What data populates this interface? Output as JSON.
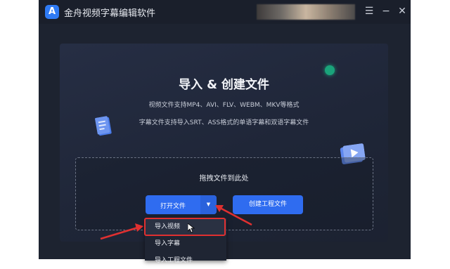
{
  "app": {
    "title": "金舟视频字幕编辑软件",
    "logo_letter": "A",
    "window_controls": {
      "menu": "☰",
      "minimize": "−",
      "close": "✕"
    }
  },
  "panel": {
    "heading": "导入 & 创建文件",
    "video_formats_text": "视频文件支持MP4、AVI、FLV、WEBM、MKV等格式",
    "subtitle_formats_text": "字幕文件支持导入SRT、ASS格式的单语字幕和双语字幕文件"
  },
  "dropzone": {
    "label": "拖拽文件到此处",
    "open_button_label": "打开文件",
    "dropdown_arrow": "▼",
    "create_project_label": "创建工程文件"
  },
  "dropdown_menu": {
    "items": [
      "导入视频",
      "导入字幕",
      "导入工程文件"
    ]
  },
  "colors": {
    "accent": "#2f6cf0",
    "annotation_red": "#e03030",
    "background": "#1d2330"
  }
}
